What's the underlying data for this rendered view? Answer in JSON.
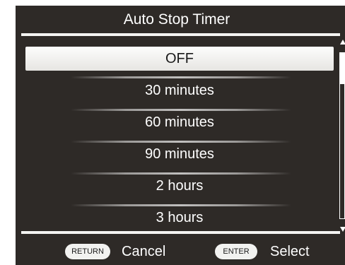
{
  "title": "Auto Stop Timer",
  "options": [
    {
      "label": "OFF",
      "selected": true
    },
    {
      "label": "30 minutes",
      "selected": false
    },
    {
      "label": "60 minutes",
      "selected": false
    },
    {
      "label": "90 minutes",
      "selected": false
    },
    {
      "label": "2 hours",
      "selected": false
    },
    {
      "label": "3 hours",
      "selected": false
    }
  ],
  "scroll": {
    "position_fraction": 0.0
  },
  "footer": {
    "return_key": "RETURN",
    "return_action": "Cancel",
    "enter_key": "ENTER",
    "enter_action": "Select"
  },
  "colors": {
    "background": "#2e2a27",
    "text": "#ffffff",
    "highlight": "#f0efec"
  }
}
